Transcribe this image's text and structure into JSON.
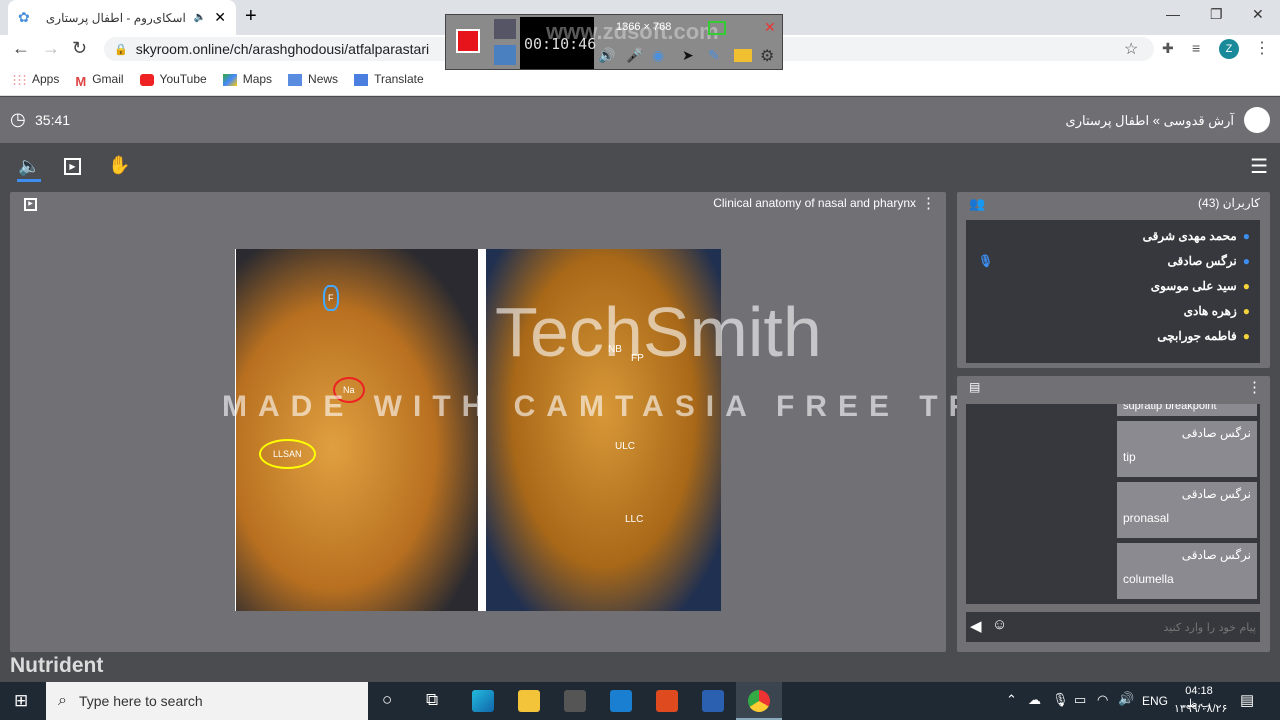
{
  "browser": {
    "tab_title": "اسکای‌روم - اطفال پرستاری",
    "url": "skyroom.online/ch/arashghodousi/atfalparastari",
    "profile_initial": "Z",
    "bookmarks": [
      "Apps",
      "Gmail",
      "YouTube",
      "Maps",
      "News",
      "Translate"
    ]
  },
  "recorder": {
    "timer": "00:10:46",
    "resolution": "1366 × 768",
    "watermark": "www.zdsoft.com"
  },
  "header": {
    "timer": "35:41",
    "breadcrumb": "آرش قدوسی » اطفال پرستاری"
  },
  "presentation": {
    "title": "Clinical anatomy of nasal and pharynx",
    "labels": [
      "F",
      "Na",
      "LLSAN",
      "NB",
      "FP",
      "ULC",
      "LLC"
    ]
  },
  "watermark": {
    "brand": "TechSmith",
    "trial": "MADE WITH CAMTASIA FREE TRIAL",
    "corner": "Nutrident"
  },
  "users": {
    "title": "کاربران (43)",
    "list": [
      {
        "name": "محمد مهدی شرقی",
        "color": "#3d8ef0"
      },
      {
        "name": "نرگس صادقی",
        "color": "#3d8ef0"
      },
      {
        "name": "سید علی موسوی",
        "color": "#f5d33a"
      },
      {
        "name": "زهره هادی",
        "color": "#f5d33a"
      },
      {
        "name": "فاطمه جورابچی",
        "color": "#f5d33a"
      }
    ]
  },
  "chat": {
    "partial_msg": "supratip breakpoint",
    "messages": [
      {
        "sender": "نرگس صادقی",
        "text": "tip"
      },
      {
        "sender": "نرگس صادقی",
        "text": "pronasal"
      },
      {
        "sender": "نرگس صادقی",
        "text": "columella"
      }
    ],
    "placeholder": "پیام خود را وارد کنید"
  },
  "taskbar": {
    "search_placeholder": "Type here to search",
    "lang": "ENG",
    "time": "04:18 ب.ظ",
    "date": "۱۳۹۹/۰۸/۲۶"
  }
}
